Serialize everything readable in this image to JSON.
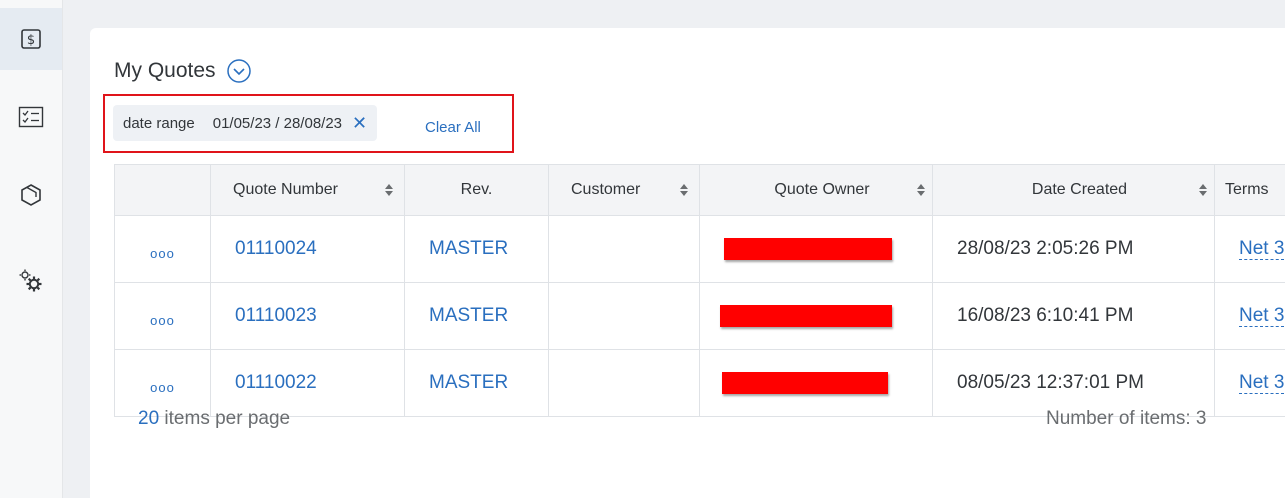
{
  "sidebar": {
    "items": [
      {
        "icon": "dollar-icon",
        "active": true
      },
      {
        "icon": "checklist-icon",
        "active": false
      },
      {
        "icon": "product-box-icon",
        "active": false
      },
      {
        "icon": "settings-gears-icon",
        "active": false
      }
    ]
  },
  "header": {
    "title": "My Quotes"
  },
  "filter": {
    "label": "date range",
    "value": "01/05/23 / 28/08/23",
    "clear_all": "Clear All"
  },
  "table": {
    "columns": [
      "",
      "Quote Number",
      "Rev.",
      "Customer",
      "Quote Owner",
      "Date Created",
      "Terms"
    ],
    "rows": [
      {
        "actions": "ooo",
        "quote_number": "01110024",
        "rev": "MASTER",
        "customer": "",
        "date_created": "28/08/23 2:05:26 PM",
        "terms": "Net 3"
      },
      {
        "actions": "ooo",
        "quote_number": "01110023",
        "rev": "MASTER",
        "customer": "",
        "date_created": "16/08/23 6:10:41 PM",
        "terms": "Net 3"
      },
      {
        "actions": "ooo",
        "quote_number": "01110022",
        "rev": "MASTER",
        "customer": "",
        "date_created": "08/05/23 12:37:01 PM",
        "terms": "Net 3"
      }
    ]
  },
  "footer": {
    "per_page_count": "20",
    "per_page_text": " items per page",
    "number_of_items": "Number of items: 3"
  },
  "colors": {
    "accent": "#2a6fbf",
    "highlight_border": "#e0141a",
    "redaction": "#ff0000"
  }
}
